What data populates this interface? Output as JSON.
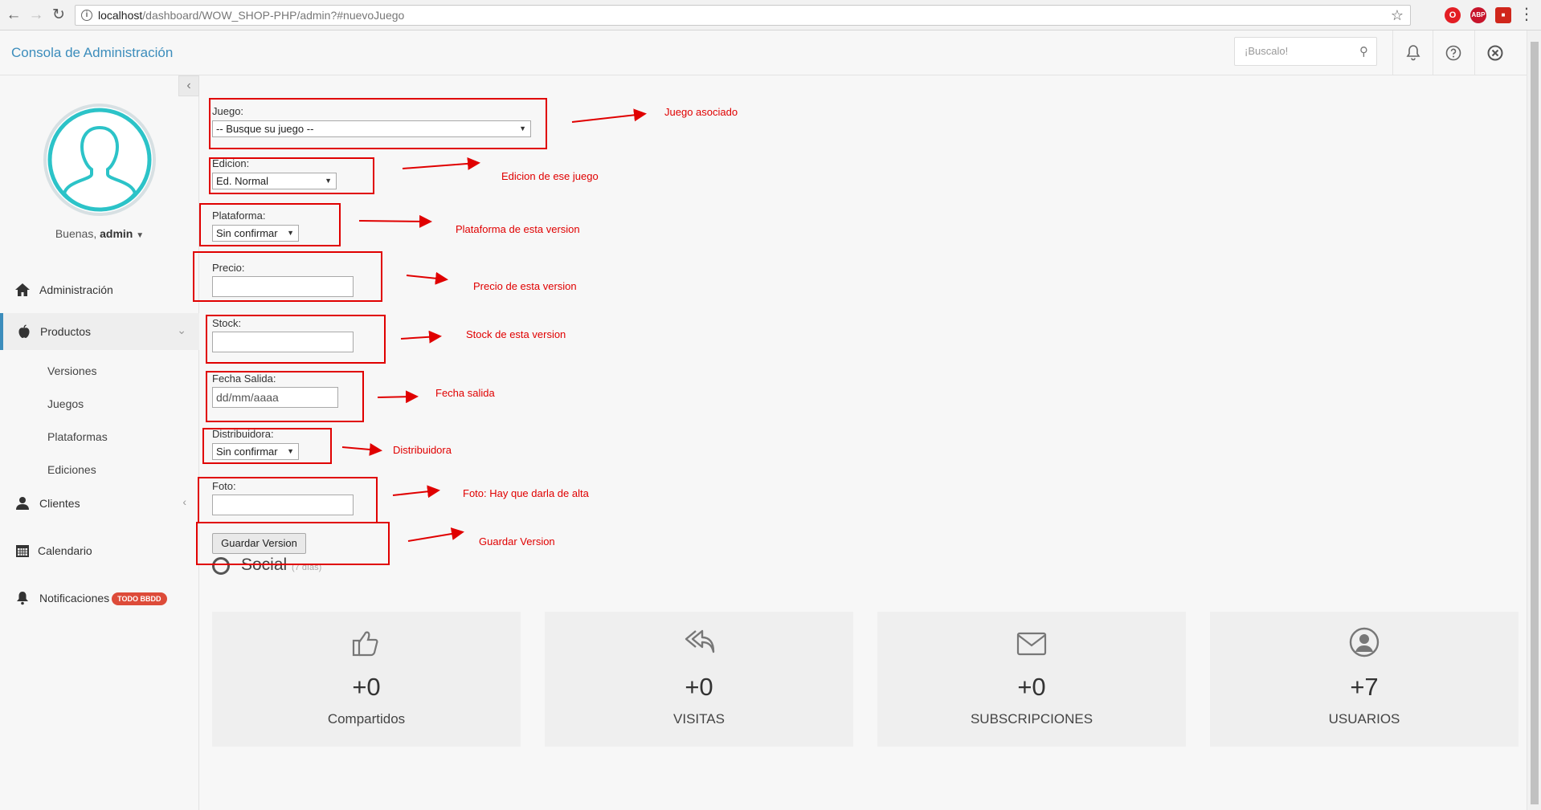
{
  "browser": {
    "url_host": "localhost",
    "url_path": "/dashboard/WOW_SHOP-PHP/admin?#nuevoJuego",
    "ext_abp": "ABP"
  },
  "header": {
    "brand": "Consola de Administración",
    "search_placeholder": "¡Buscalo!"
  },
  "sidebar": {
    "greeting": "Buenas,",
    "user": "admin",
    "items": {
      "admin": "Administración",
      "productos": "Productos",
      "clientes": "Clientes",
      "calendario": "Calendario",
      "notificaciones": "Notificaciones",
      "notif_badge": "TODO BBDD"
    },
    "sub_items": [
      "Versiones",
      "Juegos",
      "Plataformas",
      "Ediciones"
    ]
  },
  "form": {
    "juego_label": "Juego:",
    "juego_value": "-- Busque su juego --",
    "edicion_label": "Edicion:",
    "edicion_value": "Ed. Normal",
    "plataforma_label": "Plataforma:",
    "plataforma_value": "Sin confirmar",
    "precio_label": "Precio:",
    "stock_label": "Stock:",
    "fecha_label": "Fecha Salida:",
    "fecha_placeholder": "dd/mm/aaaa",
    "distribuidora_label": "Distribuidora:",
    "distribuidora_value": "Sin confirmar",
    "foto_label": "Foto:",
    "save_label": "Guardar Version"
  },
  "annotations": [
    "Juego asociado",
    "Edicion de ese juego",
    "Plataforma de esta version",
    "Precio de esta version",
    "Stock de esta version",
    "Fecha salida",
    "Distribuidora",
    "Foto: Hay que darla de alta",
    "Guardar Version"
  ],
  "social": {
    "title": "Social",
    "subtitle": "(7 días)",
    "cards": [
      {
        "value": "+0",
        "label": "Compartidos",
        "icon": "thumbs-up-icon"
      },
      {
        "value": "+0",
        "label": "VISITAS",
        "icon": "reply-all-icon"
      },
      {
        "value": "+0",
        "label": "SUBSCRIPCIONES",
        "icon": "envelope-icon"
      },
      {
        "value": "+7",
        "label": "USUARIOS",
        "icon": "user-circle-icon"
      }
    ]
  },
  "colors": {
    "accent": "#3c8dbc",
    "annotation_red": "#e00000",
    "badge_red": "#dd4b39"
  }
}
